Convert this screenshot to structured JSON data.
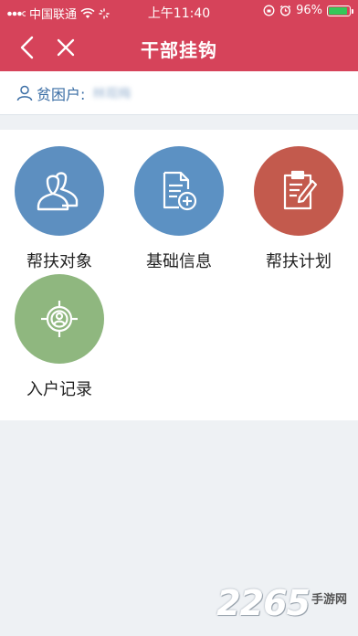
{
  "status_bar": {
    "carrier": "中国联通",
    "time": "上午11:40",
    "battery": "96%",
    "battery_level": 0.96,
    "icons": [
      "signal-icon",
      "wifi-icon",
      "loading-icon",
      "rotation-lock-icon",
      "alarm-icon",
      "battery-icon"
    ]
  },
  "nav": {
    "title": "干部挂钩",
    "back_icon": "chevron-left-icon",
    "close_icon": "close-icon"
  },
  "household": {
    "label": "贫困户:",
    "name": "林观梅"
  },
  "tiles": [
    {
      "label": "帮扶对象",
      "icon": "users-icon",
      "color": "#5d8fc0"
    },
    {
      "label": "基础信息",
      "icon": "document-add-icon",
      "color": "#5c91c3"
    },
    {
      "label": "帮扶计划",
      "icon": "clipboard-edit-icon",
      "color": "#c35a4d"
    },
    {
      "label": "入户记录",
      "icon": "target-person-icon",
      "color": "#8fb77f"
    }
  ],
  "watermark": {
    "number": "2265",
    "suffix": "手游网"
  },
  "colors": {
    "header": "#d6435a",
    "accent_blue": "#3b6ea5"
  }
}
